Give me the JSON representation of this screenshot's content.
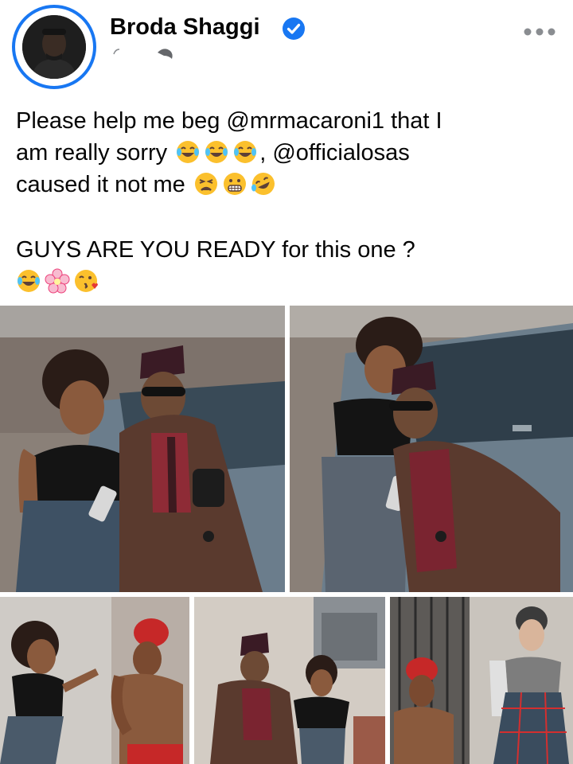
{
  "post": {
    "author": "Broda Shaggi",
    "verified": true,
    "text_lines": [
      "Please help me beg  @mrmacaroni1 that  I",
      "am really sorry",
      ",  @officialosas",
      "caused it not me",
      "GUYS ARE YOU READY for this one ?"
    ]
  },
  "icons": {
    "verified": "verified-badge-icon",
    "more": "more-options-icon",
    "meta": "globe-icon",
    "emojis_line2": [
      "tears-of-joy-emoji",
      "tears-of-joy-emoji",
      "tears-of-joy-emoji"
    ],
    "emojis_line3": [
      "weary-face-emoji",
      "grimacing-face-emoji",
      "rolling-laughing-emoji"
    ],
    "emojis_line5": [
      "tears-of-joy-emoji",
      "cherry-blossom-emoji",
      "face-blowing-kiss-emoji"
    ]
  },
  "colors": {
    "accent": "#1877f2",
    "text": "#050505",
    "muted": "#65676b"
  },
  "photos": [
    "photo-1",
    "photo-2",
    "photo-3",
    "photo-4",
    "photo-5"
  ]
}
